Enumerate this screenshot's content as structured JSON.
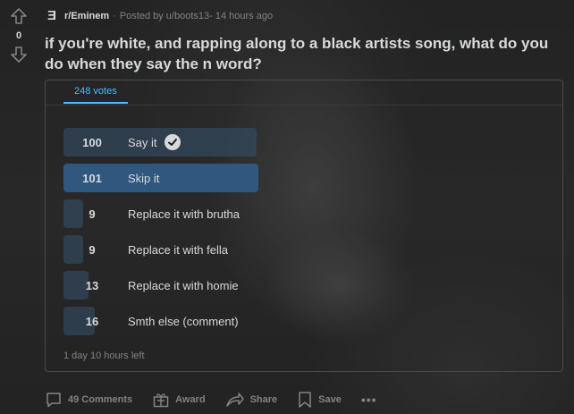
{
  "post": {
    "score": "0",
    "subreddit": "r/Eminem",
    "posted_by": "Posted by u/boots13",
    "time_ago": "14 hours ago",
    "title": "if you're white, and rapping along to a black artists song, what do you do when they say the n word?"
  },
  "poll": {
    "total_votes": "248 votes",
    "options": [
      {
        "count": "100",
        "label": "Say it",
        "fraction": 0.403
      },
      {
        "count": "101",
        "label": "Skip it",
        "fraction": 0.407
      },
      {
        "count": "9",
        "label": "Replace it with brutha",
        "fraction": 0.036
      },
      {
        "count": "9",
        "label": "Replace it with fella",
        "fraction": 0.036
      },
      {
        "count": "13",
        "label": "Replace it with homie",
        "fraction": 0.052
      },
      {
        "count": "16",
        "label": "Smth else (comment)",
        "fraction": 0.065
      }
    ],
    "time_left": "1 day 10 hours left"
  },
  "footer": {
    "comments": "49 Comments",
    "award": "Award",
    "share": "Share",
    "save": "Save",
    "more": "•••"
  },
  "colors": {
    "accent": "#4fbcff",
    "winner_bar": "#30577e",
    "muted_text": "#818384"
  }
}
